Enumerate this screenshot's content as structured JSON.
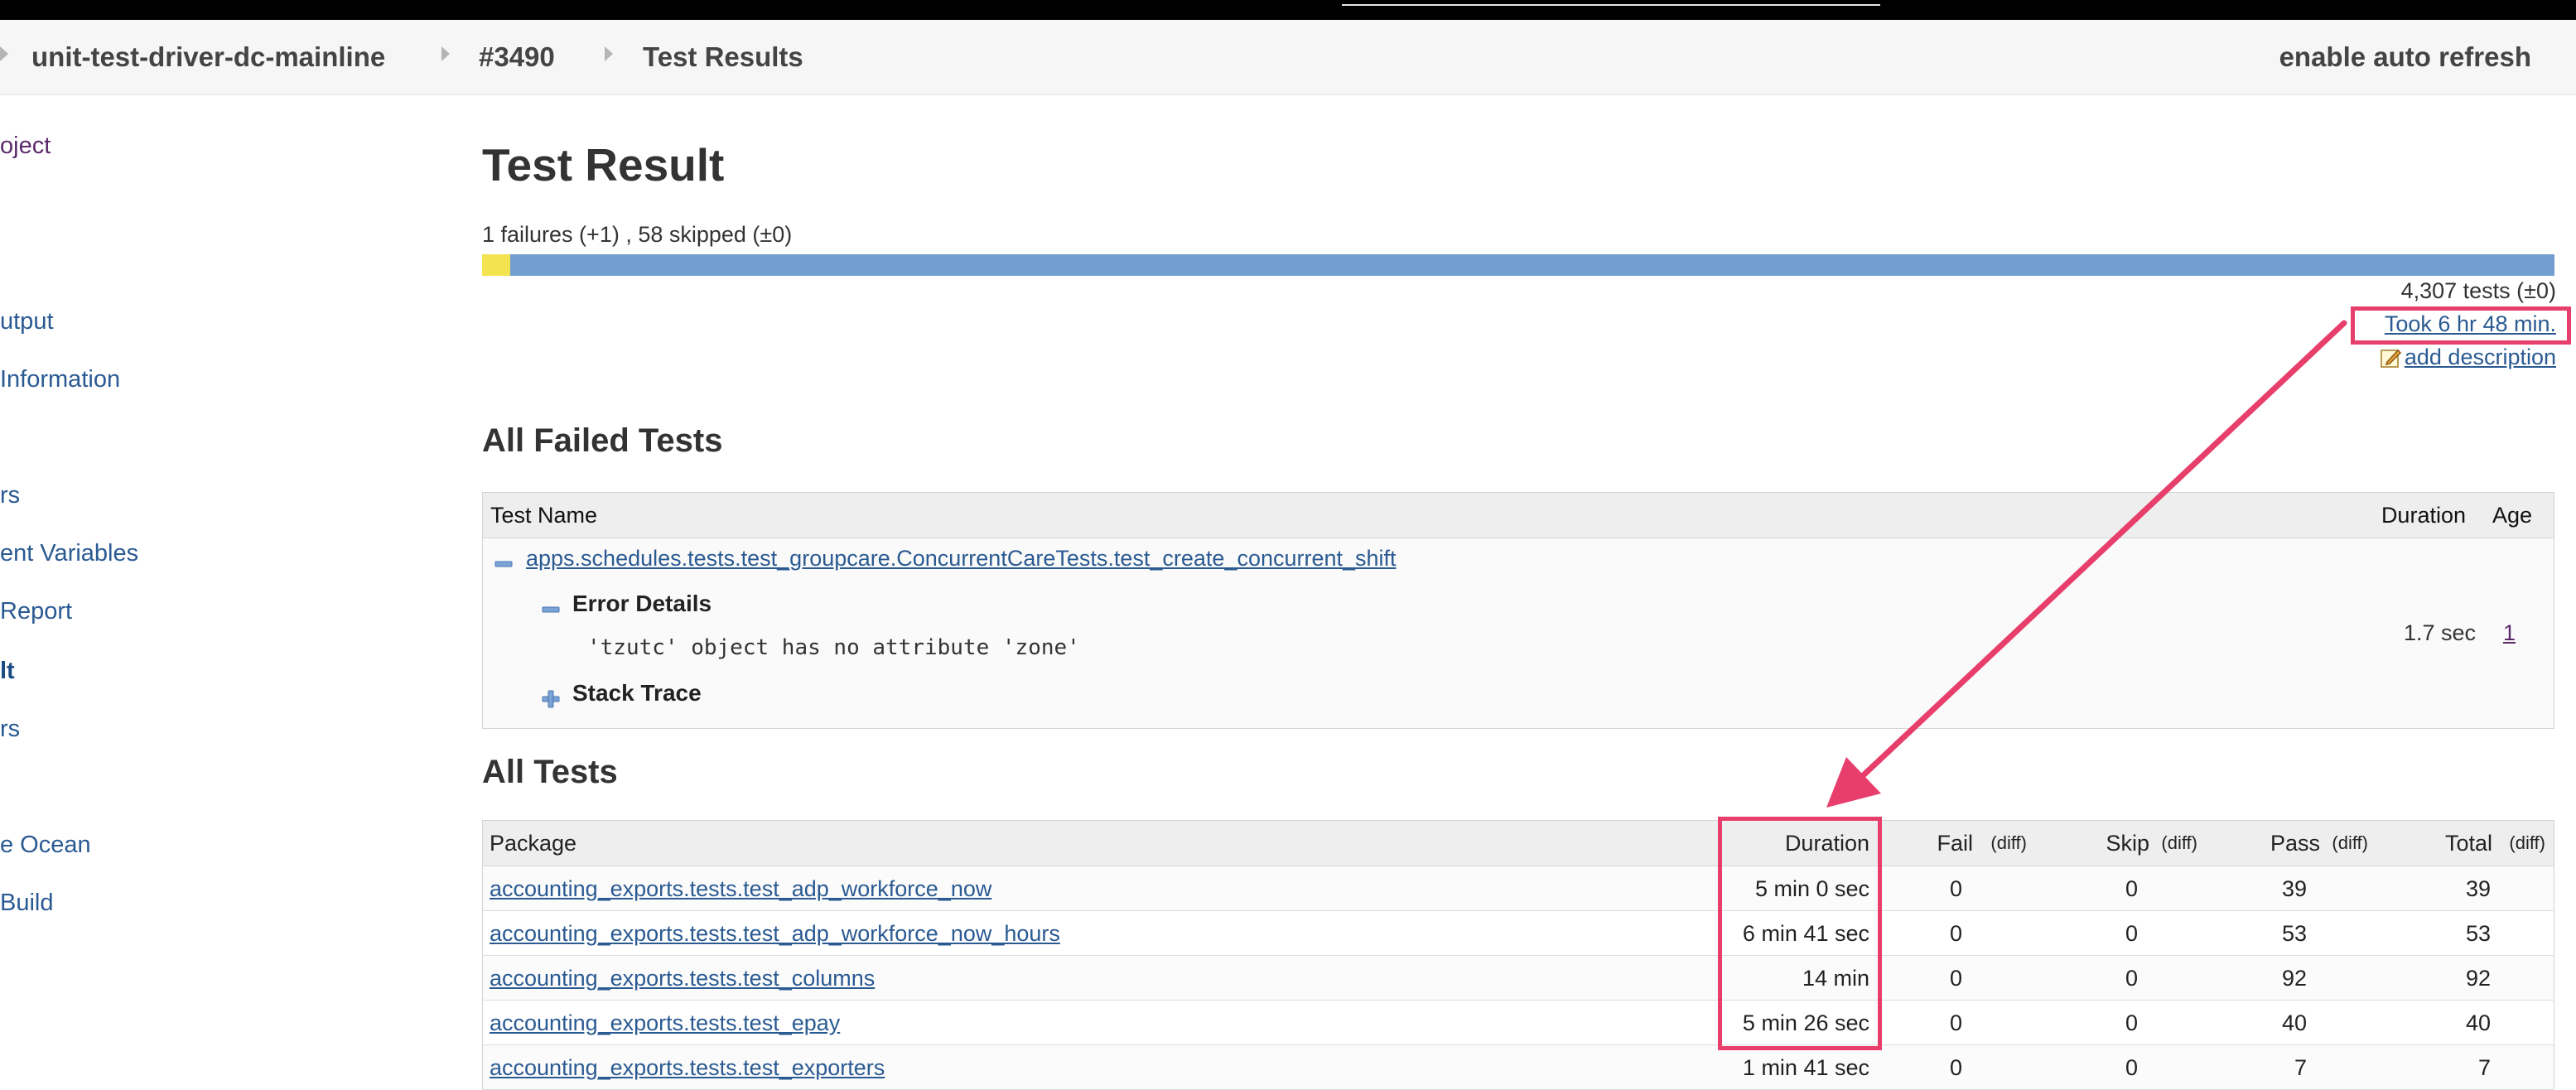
{
  "window": {
    "tab_hint": ""
  },
  "breadcrumb": {
    "items": [
      "unit-test-driver-dc-mainline",
      "#3490",
      "Test Results"
    ],
    "auto_refresh": "enable auto refresh"
  },
  "sidebar": {
    "items": [
      {
        "label": "oject",
        "state": "visited"
      },
      {
        "label": "utput",
        "state": "normal"
      },
      {
        "label": "Information",
        "state": "normal"
      },
      {
        "label": "rs",
        "state": "normal"
      },
      {
        "label": "ent Variables",
        "state": "normal"
      },
      {
        "label": "Report",
        "state": "normal"
      },
      {
        "label": "lt",
        "state": "active"
      },
      {
        "label": "rs",
        "state": "normal"
      },
      {
        "label": "e Ocean",
        "state": "normal"
      },
      {
        "label": "Build",
        "state": "normal"
      }
    ]
  },
  "main": {
    "title": "Test Result",
    "summary": "1 failures (+1) , 58 skipped (±0)",
    "progress": {
      "fail_fraction": 0.0137,
      "fail_color": "#f4e351",
      "pass_color": "#729fcf"
    },
    "tests_count": "4,307 tests (±0)",
    "took": "Took 6 hr 48 min.",
    "add_description": "add description"
  },
  "failed": {
    "heading": "All Failed Tests",
    "columns": {
      "name": "Test Name",
      "duration": "Duration",
      "age": "Age"
    },
    "test": {
      "name": "apps.schedules.tests.test_groupcare.ConcurrentCareTests.test_create_concurrent_shift",
      "error_details_label": "Error Details",
      "error_message": "'tzutc' object has no attribute 'zone'",
      "stack_trace_label": "Stack Trace",
      "duration": "1.7 sec",
      "age": "1"
    }
  },
  "all_tests": {
    "heading": "All Tests",
    "columns": {
      "package": "Package",
      "duration": "Duration",
      "fail": "Fail",
      "skip": "Skip",
      "pass": "Pass",
      "total": "Total",
      "diff": "(diff)"
    },
    "rows": [
      {
        "package": "accounting_exports.tests.test_adp_workforce_now",
        "duration": "5 min 0 sec",
        "fail": "0",
        "skip": "0",
        "pass": "39",
        "total": "39"
      },
      {
        "package": "accounting_exports.tests.test_adp_workforce_now_hours",
        "duration": "6 min 41 sec",
        "fail": "0",
        "skip": "0",
        "pass": "53",
        "total": "53"
      },
      {
        "package": "accounting_exports.tests.test_columns",
        "duration": "14 min",
        "fail": "0",
        "skip": "0",
        "pass": "92",
        "total": "92"
      },
      {
        "package": "accounting_exports.tests.test_epay",
        "duration": "5 min 26 sec",
        "fail": "0",
        "skip": "0",
        "pass": "40",
        "total": "40"
      },
      {
        "package": "accounting_exports.tests.test_exporters",
        "duration": "1 min 41 sec",
        "fail": "0",
        "skip": "0",
        "pass": "7",
        "total": "7"
      }
    ]
  },
  "annotation": {
    "color": "#e83e6c"
  }
}
